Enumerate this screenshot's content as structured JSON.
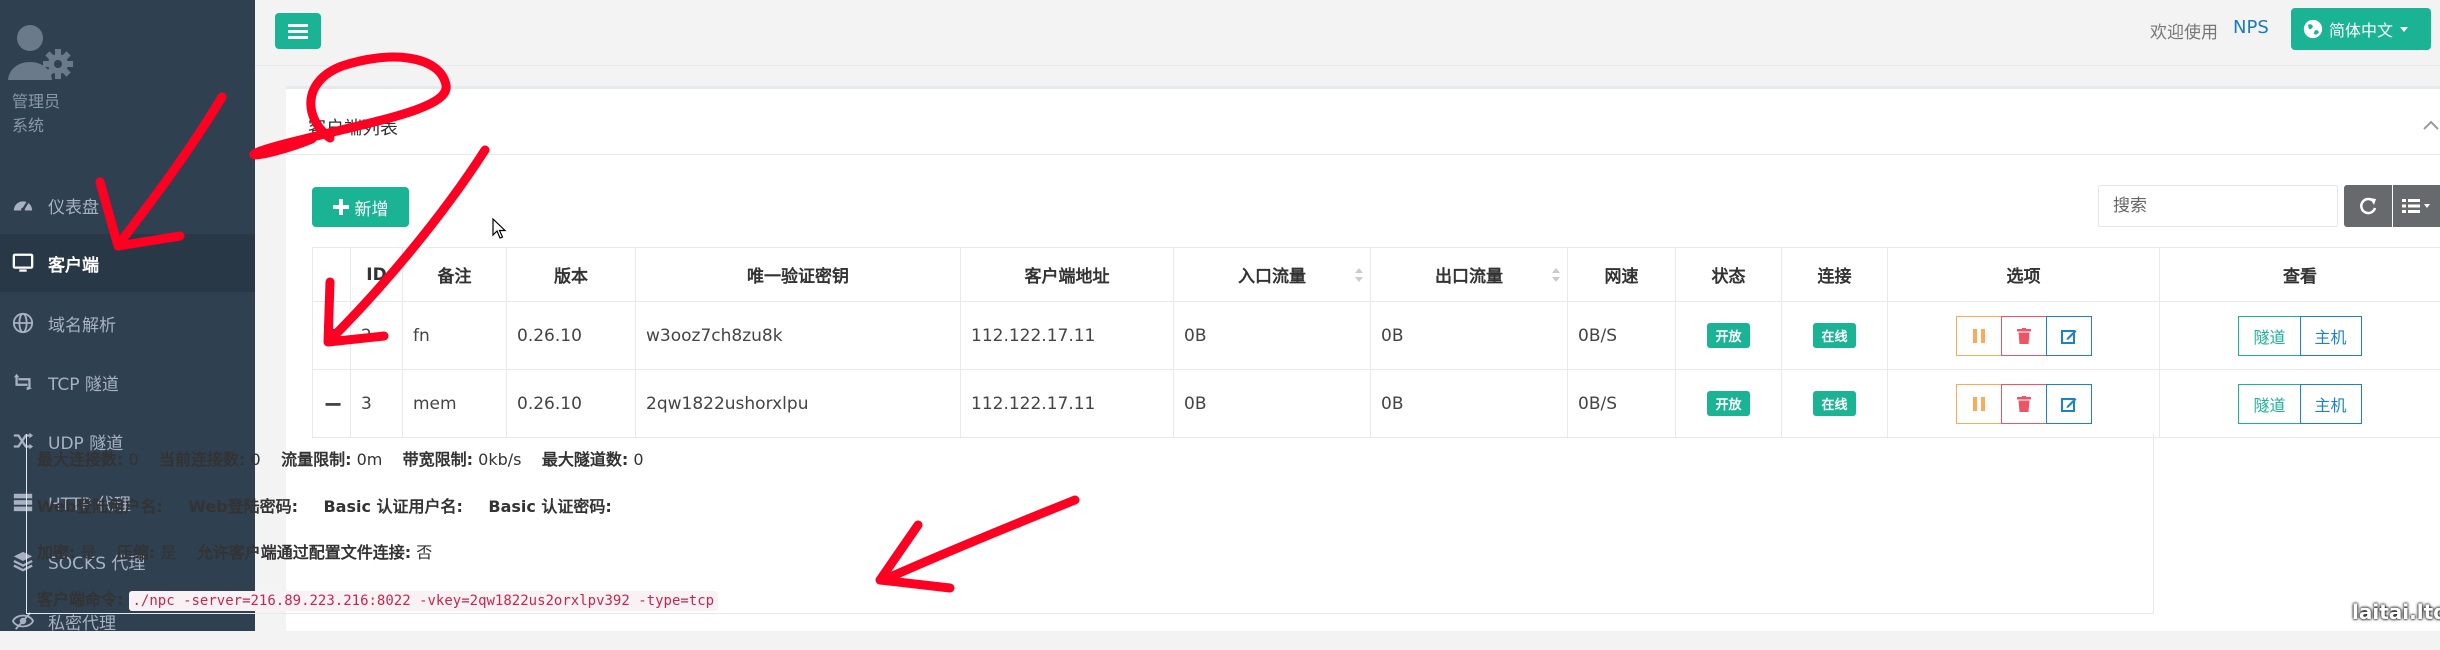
{
  "sidebar": {
    "profile": {
      "name": "管理员",
      "role": "系统"
    },
    "items": [
      {
        "label": "仪表盘",
        "icon": "dashboard-icon",
        "active": false
      },
      {
        "label": "客户端",
        "icon": "desktop-icon",
        "active": true
      },
      {
        "label": "域名解析",
        "icon": "globe-icon",
        "active": false
      },
      {
        "label": "TCP 隧道",
        "icon": "retweet-icon",
        "active": false
      },
      {
        "label": "UDP 隧道",
        "icon": "shuffle-icon",
        "active": false
      },
      {
        "label": "HTTP 代理",
        "icon": "server-icon",
        "active": false
      },
      {
        "label": "SOCKS 代理",
        "icon": "layers-icon",
        "active": false
      },
      {
        "label": "私密代理",
        "icon": "eye-slash-icon",
        "active": false
      }
    ]
  },
  "header": {
    "welcome": "欢迎使用",
    "brand": "NPS",
    "language": "简体中文"
  },
  "panel": {
    "title": "客户端列表",
    "add_label": "新增",
    "search_placeholder": "搜索"
  },
  "table": {
    "columns": [
      "",
      "ID",
      "备注",
      "版本",
      "唯一验证密钥",
      "客户端地址",
      "入口流量",
      "出口流量",
      "网速",
      "状态",
      "连接",
      "选项",
      "查看"
    ],
    "rows": [
      {
        "expand": "+",
        "id": "2",
        "remark": "fn",
        "version": "0.26.10",
        "vkey": "w3ooz7ch8zu8k",
        "addr": "112.122.17.11",
        "in": "0B",
        "out": "0B",
        "speed": "0B/S",
        "status": "开放",
        "conn": "在线",
        "view_tunnel": "隧道",
        "view_host": "主机"
      },
      {
        "expand": "−",
        "id": "3",
        "remark": "mem",
        "version": "0.26.10",
        "vkey": "2qw1822ushorxlpu",
        "addr": "112.122.17.11",
        "in": "0B",
        "out": "0B",
        "speed": "0B/S",
        "status": "开放",
        "conn": "在线",
        "view_tunnel": "隧道",
        "view_host": "主机"
      }
    ]
  },
  "detail": {
    "line1": [
      {
        "label": "最大连接数:",
        "value": "0"
      },
      {
        "label": "当前连接数:",
        "value": "0"
      },
      {
        "label": "流量限制:",
        "value": "0m"
      },
      {
        "label": "带宽限制:",
        "value": "0kb/s"
      },
      {
        "label": "最大隧道数:",
        "value": "0"
      }
    ],
    "line2": [
      {
        "label": "Web登陆用户名:",
        "value": ""
      },
      {
        "label": "Web登陆密码:",
        "value": ""
      },
      {
        "label": "Basic 认证用户名:",
        "value": ""
      },
      {
        "label": "Basic 认证密码:",
        "value": ""
      }
    ],
    "line3": [
      {
        "label": "加密:",
        "value": "是"
      },
      {
        "label": "压缩:",
        "value": "是"
      },
      {
        "label": "允许客户端通过配置文件连接:",
        "value": "否"
      }
    ],
    "command_label": "客户端命令:",
    "command": "./npc -server=216.89.223.216:8022 -vkey=2qw1822us2orxlpv392 -type=tcp"
  },
  "watermark": "laitai.ltd",
  "colors": {
    "primary": "#1ab394",
    "sidebar": "#2f4050",
    "sidebar_active": "#293846",
    "link": "#1a7bb9",
    "warning": "#f8ac59",
    "danger": "#ed5565",
    "info": "#1c84c6",
    "annotation": "#ff0022"
  }
}
